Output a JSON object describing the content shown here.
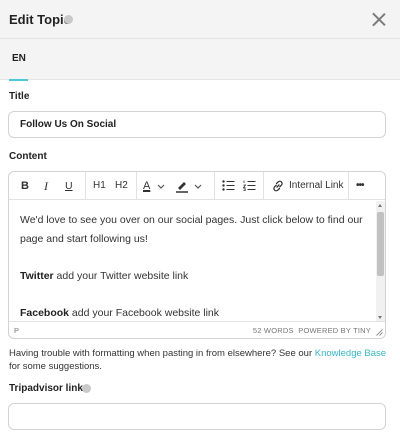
{
  "header": {
    "title": "Edit Topic"
  },
  "tabs": [
    {
      "label": "EN",
      "active": true
    }
  ],
  "title_field": {
    "label": "Title",
    "value": "Follow Us On Social"
  },
  "content_field": {
    "label": "Content",
    "toolbar": {
      "bold": "B",
      "italic": "I",
      "underline": "U",
      "h1": "H1",
      "h2": "H2",
      "text_color": "A",
      "internal_link": "Internal Link",
      "more": "•••"
    },
    "body": {
      "para1": "We'd love to see you over on our social pages. Just click below to find our page and start following us!",
      "twitter_label": "Twitter",
      "twitter_text": " add your Twitter website link",
      "facebook_label": "Facebook",
      "facebook_text": " add your Facebook website link"
    },
    "status": {
      "path": "P",
      "words": "52 WORDS",
      "powered_by": "POWERED BY TINY"
    }
  },
  "help": {
    "before": "Having trouble with formatting when pasting in from elsewhere? See our ",
    "link": "Knowledge Base",
    "after": " for some suggestions."
  },
  "tripadvisor_field": {
    "label": "Tripadvisor link",
    "value": ""
  },
  "colors": {
    "accent": "#4cc9d4",
    "link": "#36b8c5",
    "header_bg": "#f4f4f4"
  },
  "icons": [
    "info-icon",
    "close-icon",
    "text-color-icon",
    "highlight-icon",
    "bullet-list-icon",
    "numbered-list-icon",
    "link-icon",
    "more-icon"
  ]
}
